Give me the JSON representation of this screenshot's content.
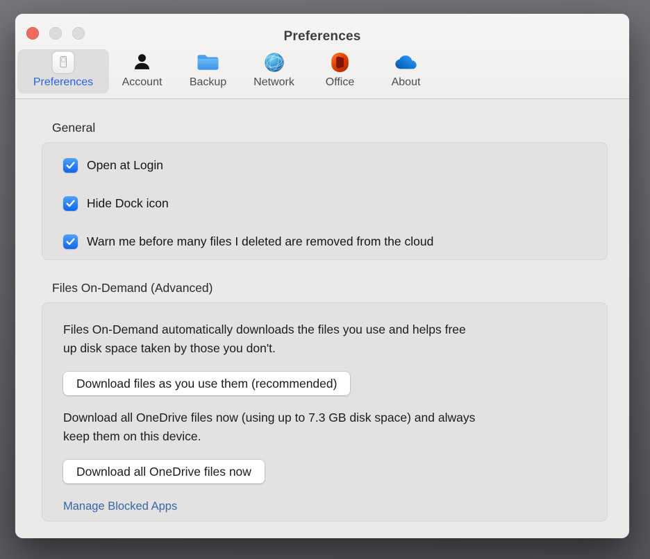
{
  "window": {
    "title": "Preferences"
  },
  "toolbar": {
    "items": [
      {
        "label": "Preferences",
        "icon": "preferences-switch-icon",
        "selected": true
      },
      {
        "label": "Account",
        "icon": "person-icon",
        "selected": false
      },
      {
        "label": "Backup",
        "icon": "folder-icon",
        "selected": false
      },
      {
        "label": "Network",
        "icon": "globe-icon",
        "selected": false
      },
      {
        "label": "Office",
        "icon": "office-logo-icon",
        "selected": false
      },
      {
        "label": "About",
        "icon": "onedrive-cloud-icon",
        "selected": false
      }
    ]
  },
  "general": {
    "header": "General",
    "checkboxes": [
      {
        "label": "Open at Login",
        "checked": true
      },
      {
        "label": "Hide Dock icon",
        "checked": true
      },
      {
        "label": "Warn me before many files I deleted are removed from the cloud",
        "checked": true
      }
    ]
  },
  "files_on_demand": {
    "header": "Files On-Demand (Advanced)",
    "description_1_line_1": "Files On-Demand automatically downloads the files you use and helps free",
    "description_1_line_2": "up disk space taken by those you don't.",
    "download_as_used_button": "Download files as you use them (recommended)",
    "description_2_line_1": "Download all OneDrive files now (using up to 7.3 GB disk space) and always",
    "description_2_line_2": "keep them on this device.",
    "download_all_button": "Download all OneDrive files now",
    "manage_blocked_apps_link": "Manage Blocked Apps"
  },
  "colors": {
    "accent_blue": "#2263ef",
    "checkbox_blue_top": "#4da2fa",
    "checkbox_blue_bottom": "#0d66ee",
    "link_blue": "#3566ac",
    "close_button_red": "#ee6a5f",
    "window_background": "#efeeed",
    "group_box_background": "#e3e2e1"
  }
}
